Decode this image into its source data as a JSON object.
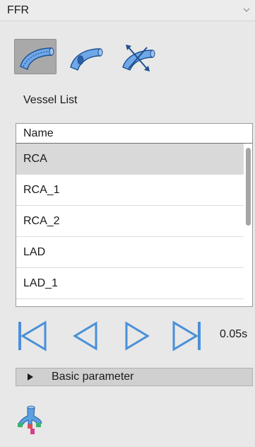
{
  "header": {
    "title": "FFR",
    "collapse_icon": "chevron-down-icon"
  },
  "toolbar": {
    "tools": [
      {
        "icon": "vessel-centerline-icon",
        "active": true
      },
      {
        "icon": "vessel-probe-icon",
        "active": false
      },
      {
        "icon": "vessel-transform-icon",
        "active": false
      }
    ]
  },
  "vessel_list": {
    "label": "Vessel List",
    "column_header": "Name",
    "rows": [
      "RCA",
      "RCA_1",
      "RCA_2",
      "LAD",
      "LAD_1"
    ],
    "selected_index": 0
  },
  "playback": {
    "buttons": [
      "skip-to-start-icon",
      "previous-icon",
      "play-icon",
      "skip-to-end-icon"
    ],
    "time": "0.05s"
  },
  "basic_parameter": {
    "label": "Basic parameter",
    "expanded": false
  },
  "bottom_tool": {
    "icon": "vessel-tree-icon"
  },
  "colors": {
    "accent_blue": "#4a90d9",
    "panel_bg": "#e8e8e8",
    "selected_row": "#d9d9d9"
  }
}
